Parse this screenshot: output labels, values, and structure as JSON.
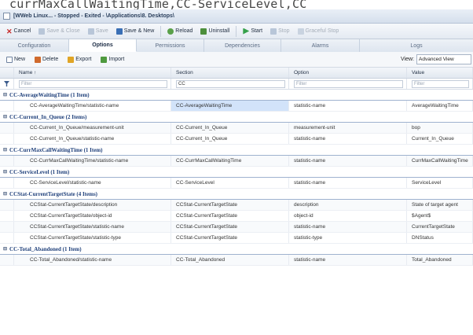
{
  "banner": "currMaxCallWaitingTime,CC-ServiceLevel,CC",
  "window": {
    "title": "[WWeb Linux... - Stopped - Exited - \\Applications\\8. Desktops\\"
  },
  "toolbar": [
    {
      "key": "cancel",
      "label": "Cancel",
      "icon": "close-icon",
      "disabled": false
    },
    {
      "key": "save-close",
      "label": "Save & Close",
      "icon": "save-icon",
      "disabled": true
    },
    {
      "key": "save",
      "label": "Save",
      "icon": "save-icon",
      "disabled": true
    },
    {
      "key": "save-new",
      "label": "Save & New",
      "icon": "save-icon",
      "disabled": false
    },
    {
      "key": "reload",
      "label": "Reload",
      "icon": "reload-icon",
      "disabled": false
    },
    {
      "key": "uninstall",
      "label": "Uninstall",
      "icon": "uninstall-icon",
      "disabled": false
    },
    {
      "key": "start",
      "label": "Start",
      "icon": "start-icon",
      "disabled": false
    },
    {
      "key": "stop",
      "label": "Stop",
      "icon": "stop-icon",
      "disabled": true
    },
    {
      "key": "graceful-stop",
      "label": "Graceful Stop",
      "icon": "graceful-stop-icon",
      "disabled": true
    }
  ],
  "tabs": [
    {
      "label": "Configuration",
      "active": false
    },
    {
      "label": "Options",
      "active": true
    },
    {
      "label": "Permissions",
      "active": false
    },
    {
      "label": "Dependencies",
      "active": false
    },
    {
      "label": "Alarms",
      "active": false
    },
    {
      "label": "Logs",
      "active": false
    }
  ],
  "options_toolbar": {
    "new_label": "New",
    "delete_label": "Delete",
    "export_label": "Export",
    "import_label": "Import",
    "view_label": "View:",
    "view_value": "Advanced View"
  },
  "grid": {
    "columns": [
      "Name ↑",
      "Section",
      "Option",
      "Value"
    ],
    "filters": [
      "Filter",
      "CC",
      "Filter",
      "Filter"
    ],
    "groups": [
      {
        "title": "CC-AverageWaitingTime (1 Item)",
        "rows": [
          [
            "CC-AverageWaitingTime/statistic-name",
            "CC-AverageWaitingTime",
            "statistic-name",
            "AverageWaitingTime"
          ]
        ]
      },
      {
        "title": "CC-Current_In_Queue (2 Items)",
        "rows": [
          [
            "CC-Current_In_Queue/measurement-unit",
            "CC-Current_In_Queue",
            "measurement-unit",
            "bop"
          ],
          [
            "CC-Current_In_Queue/statistic-name",
            "CC-Current_In_Queue",
            "statistic-name",
            "Current_In_Queue"
          ]
        ]
      },
      {
        "title": "CC-CurrMaxCallWaitingTime (1 Item)",
        "rows": [
          [
            "CC-CurrMaxCallWaitingTime/statistic-name",
            "CC-CurrMaxCallWaitingTime",
            "statistic-name",
            "CurrMaxCallWaitingTime"
          ]
        ]
      },
      {
        "title": "CC-ServiceLevel (1 Item)",
        "rows": [
          [
            "CC-ServiceLevel/statistic-name",
            "CC-ServiceLevel",
            "statistic-name",
            "ServiceLevel"
          ]
        ]
      },
      {
        "title": "CCStat-CurrentTargetState (4 Items)",
        "rows": [
          [
            "CCStat-CurrentTargetState/description",
            "CCStat-CurrentTargetState",
            "description",
            "State of target agent"
          ],
          [
            "CCStat-CurrentTargetState/object-id",
            "CCStat-CurrentTargetState",
            "object-id",
            "$Agent$"
          ],
          [
            "CCStat-CurrentTargetState/statistic-name",
            "CCStat-CurrentTargetState",
            "statistic-name",
            "CurrentTargetState"
          ],
          [
            "CCStat-CurrentTargetState/statistic-type",
            "CCStat-CurrentTargetState",
            "statistic-type",
            "DNStatus"
          ]
        ]
      },
      {
        "title": "CC-Total_Abandoned (1 Item)",
        "rows": [
          [
            "CC-Total_Abandoned/statistic-name",
            "CC-Total_Abandoned",
            "statistic-name",
            "Total_Abandoned"
          ]
        ]
      }
    ]
  }
}
